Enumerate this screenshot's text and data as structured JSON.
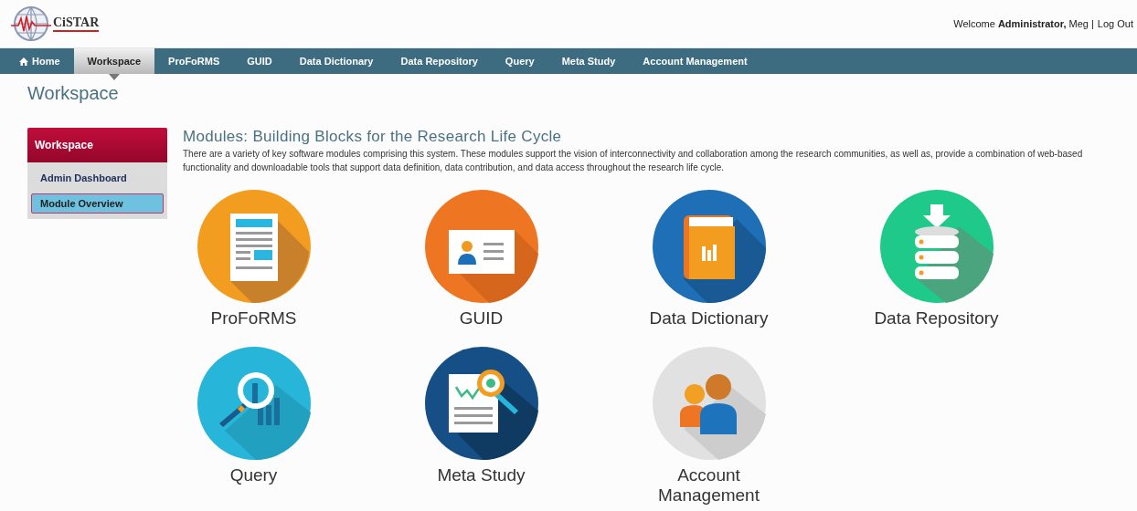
{
  "header": {
    "logo_text": "CiSTAR",
    "welcome": "Welcome **Administrator,** Meg |",
    "logout": "Log Out"
  },
  "nav": [
    {
      "label": "Home",
      "kind": "home",
      "selected": false
    },
    {
      "label": "Workspace",
      "kind": "text",
      "selected": true
    },
    {
      "label": "ProFoRMS",
      "kind": "text",
      "selected": false
    },
    {
      "label": "GUID",
      "kind": "text",
      "selected": false
    },
    {
      "label": "Data Dictionary",
      "kind": "text",
      "selected": false
    },
    {
      "label": "Data Repository",
      "kind": "text",
      "selected": false
    },
    {
      "label": "Query",
      "kind": "text",
      "selected": false
    },
    {
      "label": "Meta Study",
      "kind": "text",
      "selected": false
    },
    {
      "label": "Account Management",
      "kind": "text",
      "selected": false
    }
  ],
  "page_title": "Workspace",
  "sidebar": {
    "title": "Workspace",
    "items": [
      {
        "label": "Admin Dashboard",
        "selected": false
      },
      {
        "label": "Module Overview",
        "selected": true
      }
    ]
  },
  "modules_heading": "Modules: Building Blocks for the Research Life Cycle",
  "modules_intro": "There are a variety of key software modules comprising this system. These modules support the vision of interconnectivity and collaboration among the research communities, as well as, provide a combination of web-based functionality and downloadable tools that support data definition, data contribution, and data access throughout the research life cycle.",
  "modules": [
    {
      "label": "ProFoRMS",
      "kind": "proforms"
    },
    {
      "label": "GUID",
      "kind": "guid"
    },
    {
      "label": "Data Dictionary",
      "kind": "dictionary"
    },
    {
      "label": "Data Repository",
      "kind": "repository"
    },
    {
      "label": "Query",
      "kind": "query"
    },
    {
      "label": "Meta Study",
      "kind": "meta"
    },
    {
      "label": "Account Management",
      "kind": "account"
    }
  ]
}
